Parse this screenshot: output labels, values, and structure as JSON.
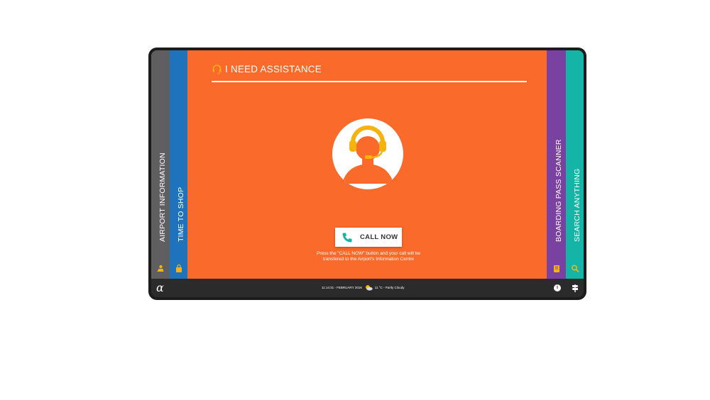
{
  "left_tabs": [
    {
      "label": "AIRPORT INFORMATION",
      "icon": "person-location-icon",
      "color": "#5f5f5f"
    },
    {
      "label": "TIME TO SHOP",
      "icon": "shopping-bag-icon",
      "color": "#1f73bc"
    }
  ],
  "right_tabs": [
    {
      "label": "BOARDING PASS SCANNER",
      "icon": "boarding-pass-icon",
      "color": "#7a42a0"
    },
    {
      "label": "SEARCH ANYTHING",
      "icon": "search-icon",
      "color": "#14b5a6"
    }
  ],
  "main": {
    "title": "I NEED ASSISTANCE",
    "title_icon": "headset-icon",
    "avatar_icon": "support-agent-icon",
    "call_button": "CALL NOW",
    "call_note": "Press the \"CALL NOW\" button and your call will be transfered to the Airport's Information Centre",
    "accent_color": "#f96a2b"
  },
  "status_bar": {
    "logo": "α",
    "datetime": "11:14:31 - FEBRUARY 2016",
    "weather": "11 °C - Partly Cloudy",
    "weather_icon": "partly-cloudy-icon",
    "info_icon": "info-icon",
    "directions_icon": "signpost-icon"
  }
}
